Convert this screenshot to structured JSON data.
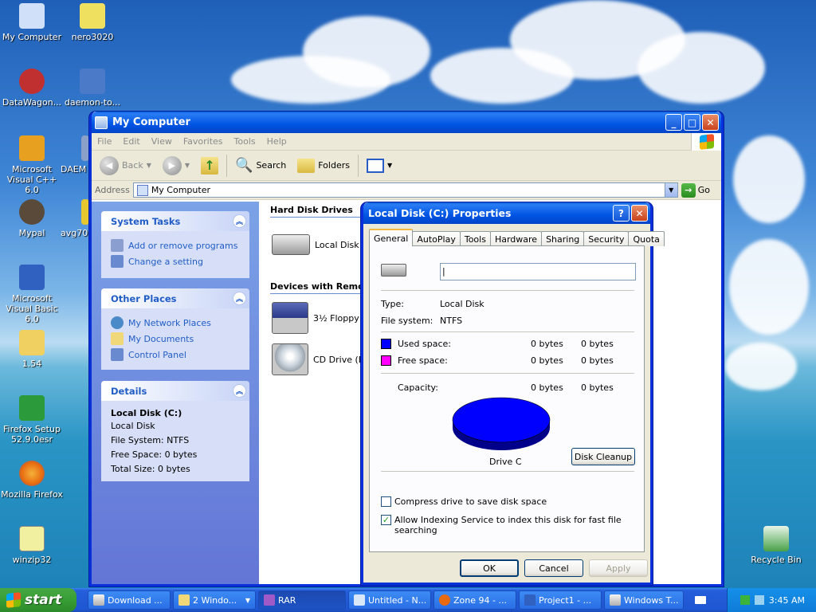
{
  "desktop": {
    "icons": [
      {
        "label": "My Computer",
        "color": "#cfe0f8"
      },
      {
        "label": "nero3020",
        "color": "#f0e060"
      },
      {
        "label": "DataWagon...",
        "color": "#c03030"
      },
      {
        "label": "daemon-to...",
        "color": "#4a7ac8"
      },
      {
        "label": "Microsoft Visual C++ 6.0",
        "color": "#e8a020"
      },
      {
        "label": "DAEM",
        "color": "#8aa0c8"
      },
      {
        "label": "Mypal",
        "color": "#5a4a3a"
      },
      {
        "label": "avg70",
        "color": "#e8c830"
      },
      {
        "label": "Microsoft Visual Basic 6.0",
        "color": "#3060c0"
      },
      {
        "label": "1.54",
        "color": "#f0d060"
      },
      {
        "label": "Firefox Setup 52.9.0esr",
        "color": "#2a9a3a"
      },
      {
        "label": "Mozilla Firefox",
        "color": "#e86a10"
      },
      {
        "label": "winzip32",
        "color": "#f0f0a0"
      },
      {
        "label": "Recycle Bin",
        "color": "#48a048"
      }
    ]
  },
  "explorer": {
    "title": "My Computer",
    "menu": [
      "File",
      "Edit",
      "View",
      "Favorites",
      "Tools",
      "Help"
    ],
    "toolbar": {
      "back": "Back",
      "search": "Search",
      "folders": "Folders"
    },
    "address": {
      "label": "Address",
      "value": "My Computer",
      "go": "Go"
    },
    "system_tasks": {
      "title": "System Tasks",
      "items": [
        "Add or remove programs",
        "Change a setting"
      ]
    },
    "other_places": {
      "title": "Other Places",
      "items": [
        "My Network Places",
        "My Documents",
        "Control Panel"
      ]
    },
    "details": {
      "title": "Details",
      "name": "Local Disk (C:)",
      "type": "Local Disk",
      "fs": "File System: NTFS",
      "free": "Free Space: 0 bytes",
      "total": "Total Size: 0 bytes"
    },
    "groups": {
      "hdd": "Hard Disk Drives",
      "removable": "Devices with Remov"
    },
    "drives": {
      "c": "Local Disk (C",
      "floppy": "3½ Floppy (",
      "cd": "CD Drive (E:"
    }
  },
  "dialog": {
    "title": "Local Disk (C:) Properties",
    "tabs": [
      "General",
      "AutoPlay",
      "Tools",
      "Hardware",
      "Sharing",
      "Security",
      "Quota"
    ],
    "name_value": "|",
    "type_label": "Type:",
    "type_value": "Local Disk",
    "fs_label": "File system:",
    "fs_value": "NTFS",
    "used_label": "Used space:",
    "used_bytes": "0 bytes",
    "used_gb": "0 bytes",
    "free_label": "Free space:",
    "free_bytes": "0 bytes",
    "free_gb": "0 bytes",
    "cap_label": "Capacity:",
    "cap_bytes": "0 bytes",
    "cap_gb": "0 bytes",
    "drive_label": "Drive C",
    "cleanup": "Disk Cleanup",
    "compress": "Compress drive to save disk space",
    "compress_checked": false,
    "indexing": "Allow Indexing Service to index this disk for fast file searching",
    "indexing_checked": true,
    "ok": "OK",
    "cancel": "Cancel",
    "apply": "Apply",
    "used_color": "#0000ff",
    "free_color": "#ff00ff"
  },
  "taskbar": {
    "start": "start",
    "items": [
      "Download ...",
      "2 Windo...",
      "RAR",
      "Untitled - N...",
      "Zone 94 - ...",
      "Project1 - ...",
      "Windows T..."
    ],
    "time": "3:45 AM"
  }
}
